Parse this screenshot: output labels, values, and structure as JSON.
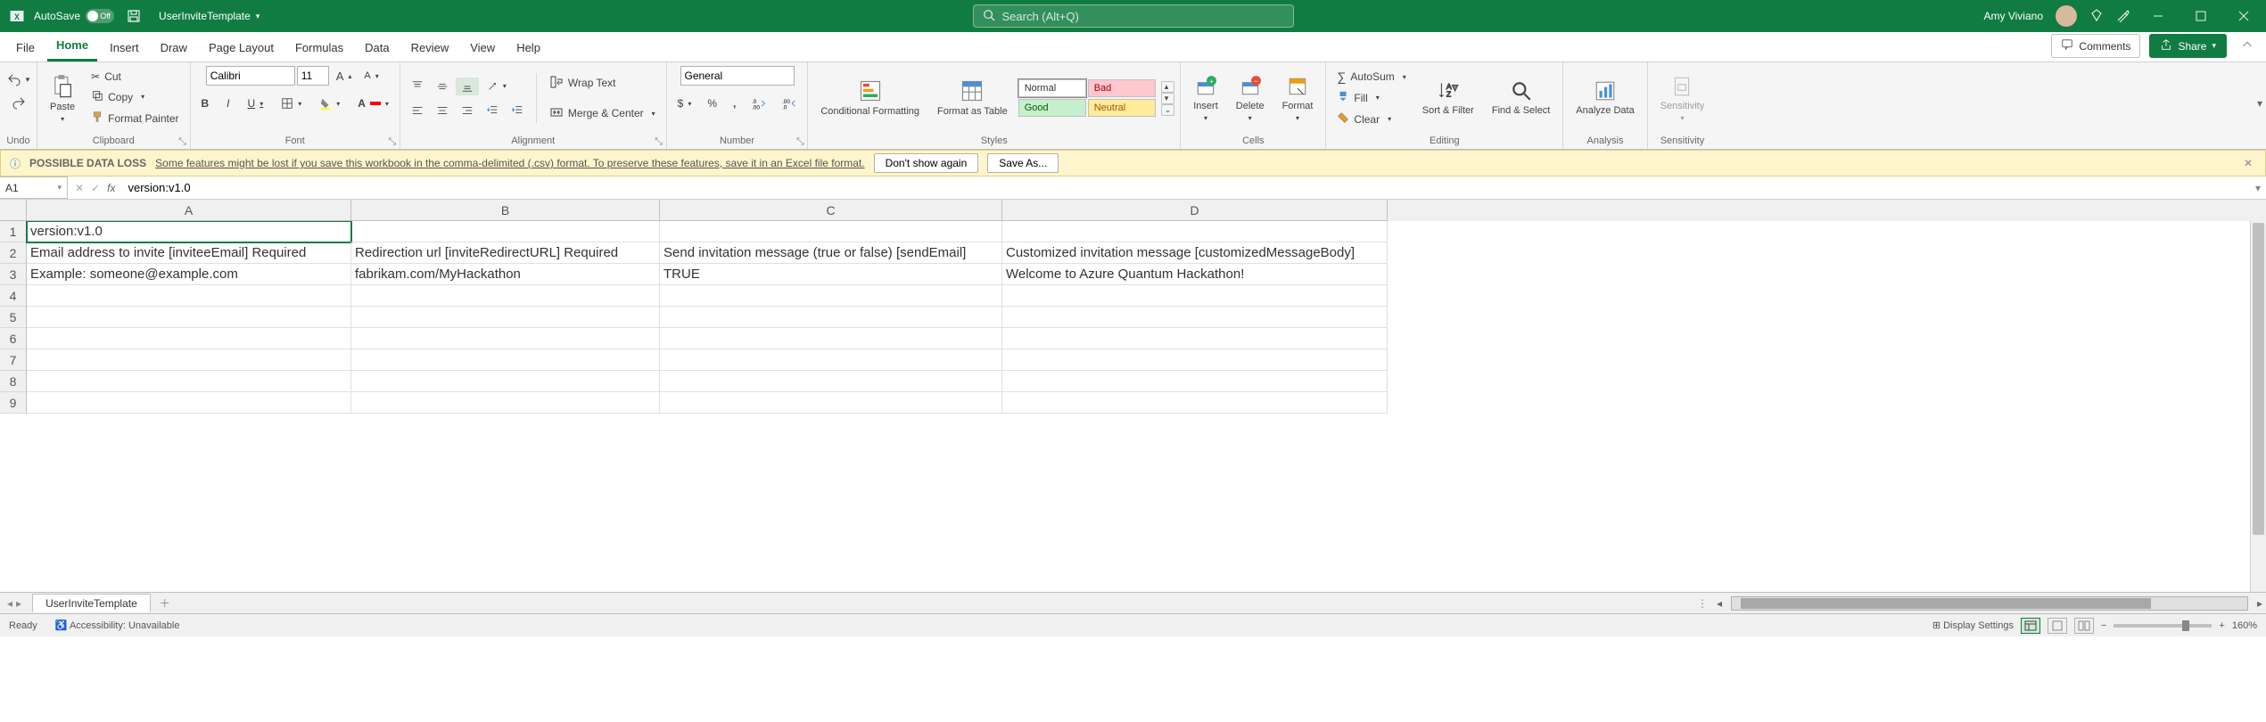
{
  "titlebar": {
    "autosave_label": "AutoSave",
    "autosave_state": "Off",
    "filename": "UserInviteTemplate",
    "search_placeholder": "Search (Alt+Q)",
    "username": "Amy Viviano"
  },
  "tabs": {
    "file": "File",
    "home": "Home",
    "insert": "Insert",
    "draw": "Draw",
    "page_layout": "Page Layout",
    "formulas": "Formulas",
    "data": "Data",
    "review": "Review",
    "view": "View",
    "help": "Help",
    "comments": "Comments",
    "share": "Share"
  },
  "ribbon": {
    "undo_group": "Undo",
    "clipboard": {
      "paste": "Paste",
      "cut": "Cut",
      "copy": "Copy",
      "format_painter": "Format Painter",
      "label": "Clipboard"
    },
    "font": {
      "name": "Calibri",
      "size": "11",
      "label": "Font"
    },
    "alignment": {
      "wrap": "Wrap Text",
      "merge": "Merge & Center",
      "label": "Alignment"
    },
    "number": {
      "format": "General",
      "label": "Number"
    },
    "styles": {
      "cond": "Conditional Formatting",
      "table": "Format as Table",
      "normal": "Normal",
      "bad": "Bad",
      "good": "Good",
      "neutral": "Neutral",
      "label": "Styles"
    },
    "cells": {
      "insert": "Insert",
      "delete": "Delete",
      "format": "Format",
      "label": "Cells"
    },
    "editing": {
      "autosum": "AutoSum",
      "fill": "Fill",
      "clear": "Clear",
      "sort": "Sort & Filter",
      "find": "Find & Select",
      "label": "Editing"
    },
    "analysis": {
      "analyze": "Analyze Data",
      "label": "Analysis"
    },
    "sensitivity": {
      "btn": "Sensitivity",
      "label": "Sensitivity"
    }
  },
  "msgbar": {
    "title": "POSSIBLE DATA LOSS",
    "text": "Some features might be lost if you save this workbook in the comma-delimited (.csv) format. To preserve these features, save it in an Excel file format.",
    "dont_show": "Don't show again",
    "save_as": "Save As..."
  },
  "formula": {
    "namebox": "A1",
    "value": "version:v1.0"
  },
  "columns": [
    "A",
    "B",
    "C",
    "D"
  ],
  "rows": [
    "1",
    "2",
    "3",
    "4",
    "5",
    "6",
    "7",
    "8",
    "9"
  ],
  "cells": {
    "A1": "version:v1.0",
    "A2": "Email address to invite [inviteeEmail] Required",
    "B2": "Redirection url [inviteRedirectURL] Required",
    "C2": "Send invitation message (true or false) [sendEmail]",
    "D2": "Customized invitation message [customizedMessageBody]",
    "A3": "Example:    someone@example.com",
    "B3": "fabrikam.com/MyHackathon",
    "C3": "TRUE",
    "D3": " Welcome to Azure Quantum Hackathon!"
  },
  "sheet": {
    "name": "UserInviteTemplate"
  },
  "status": {
    "ready": "Ready",
    "accessibility": "Accessibility: Unavailable",
    "display": "Display Settings",
    "zoom": "160%"
  }
}
